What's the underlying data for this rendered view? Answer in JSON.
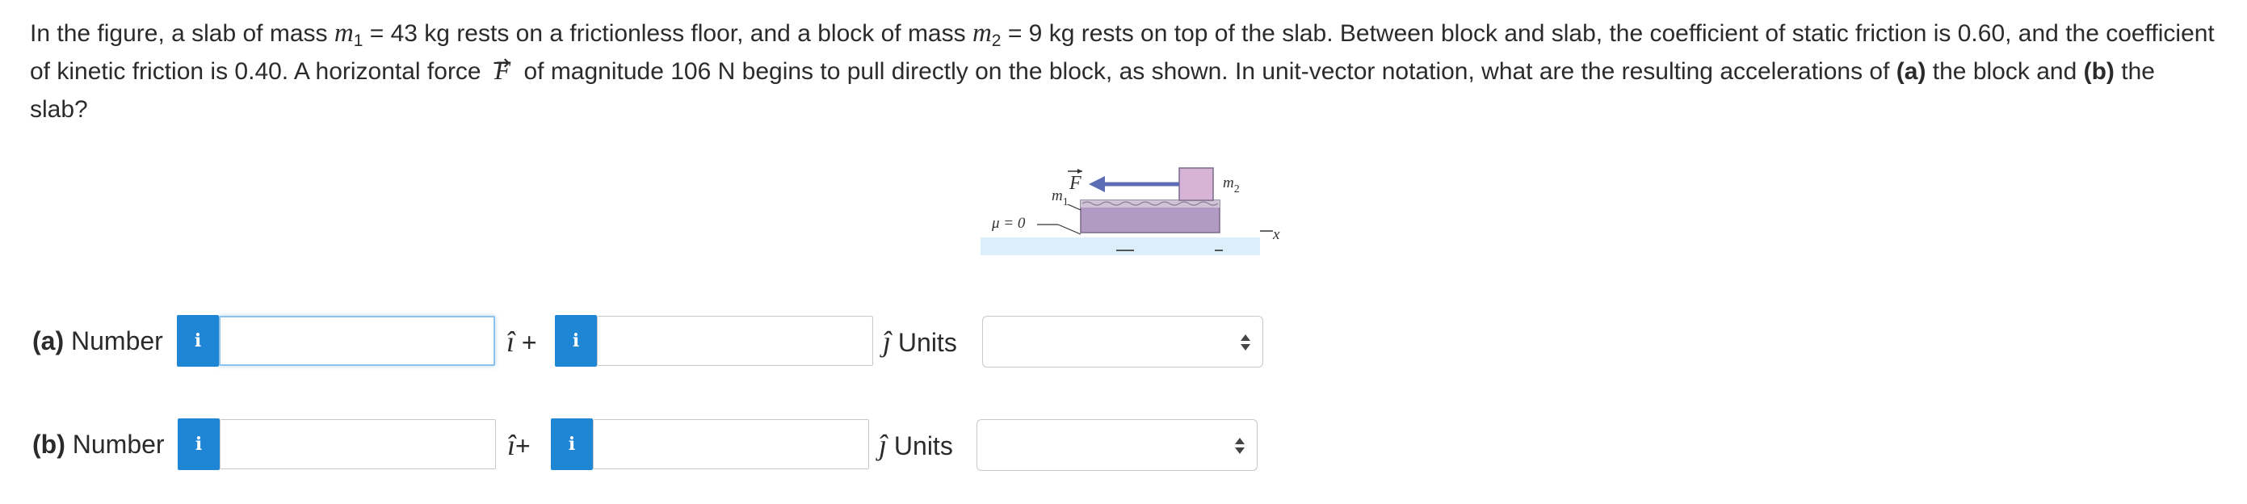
{
  "question": {
    "part1": "In the figure, a slab of mass ",
    "m1": "m",
    "m1_sub": "1",
    "part2": " = 43 kg rests on a frictionless floor, and a block of mass ",
    "m2": "m",
    "m2_sub": "2",
    "part3": " = 9 kg rests on top of the slab. Between block and slab, the coefficient of static friction is 0.60, and the coefficient of kinetic friction is 0.40. A horizontal force ",
    "force_symbol": "F",
    "force_arrow": "→",
    "part4": " of magnitude 106 N begins to pull directly on the block, as shown. In unit-vector notation, what are the resulting accelerations of ",
    "part_a": "(a)",
    "part5": " the block and ",
    "part_b": "(b)",
    "part6": " the slab?"
  },
  "figure": {
    "force_label": "F",
    "m1_label": "m",
    "m1_sub": "1",
    "m2_label": "m",
    "m2_sub": "2",
    "mu_label": "μ = 0",
    "x_label": "x",
    "colors": {
      "slab": "#b19bc4",
      "block": "#d8b3d8",
      "arrow": "#5c6db5",
      "floor": "#dceef9"
    }
  },
  "rows": [
    {
      "letter": "(a)",
      "label": " Number",
      "info_icon": "i",
      "i_hat": "î",
      "plus": " +",
      "j_hat": "ĵ",
      "units_label": " Units",
      "value_i": "",
      "value_j": "",
      "units_value": ""
    },
    {
      "letter": "(b)",
      "label": " Number",
      "info_icon": "i",
      "i_hat": "î",
      "plus": "+",
      "j_hat": "ĵ",
      "units_label": " Units",
      "value_i": "",
      "value_j": "",
      "units_value": ""
    }
  ],
  "colors": {
    "info_button": "#1f86d6",
    "input_border": "#c8c8c8",
    "focus_border": "#8ec1ec"
  }
}
